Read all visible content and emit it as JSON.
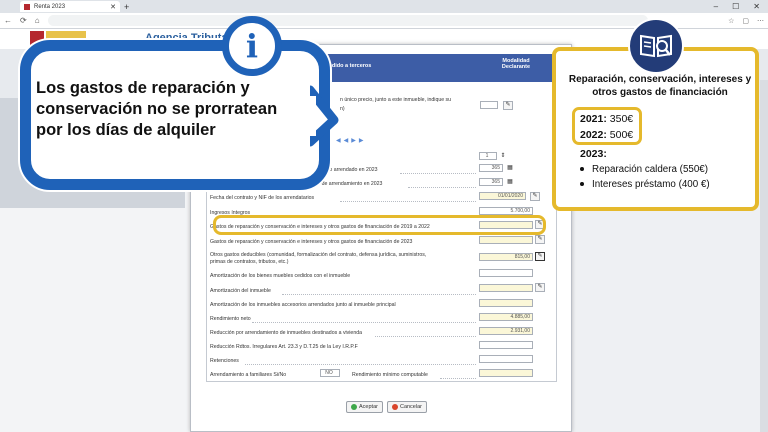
{
  "browser": {
    "tab_title": "Renta 2023",
    "tab_close": "✕",
    "new_tab": "+",
    "window_buttons": [
      "–",
      "☐",
      "✕"
    ],
    "nav": [
      "←",
      "⟳",
      "⌂"
    ]
  },
  "site": {
    "agency": "Agencia Tributaria"
  },
  "dialog": {
    "header_title": "o o cedido a terceros",
    "header_modalidad": "Modalidad Declarante",
    "row_precio": "n único precio, junto a este inmueble, indique su",
    "row_precio2": "n)",
    "stepper_value": "1",
    "row_dias_arrendado": "le ha estado arrendado en 2023",
    "dias_arrendado": "365",
    "row_dias_contrato": "ontrato de arrendamiento en 2023",
    "dias_contrato": "365",
    "row_fecha": "Fecha del contrato y NIF de los arrendatarios",
    "fecha": "01/01/2020",
    "row_ingresos": "Ingresos íntegros",
    "ingresos": "5.700,00",
    "row_gastos_anteriores": "Gastos de reparación y conservación e intereses y otros gastos de financiación de 2019 a 2022",
    "row_gastos_2023": "Gastos de reparación y conservación e intereses y otros gastos de financiación de 2023",
    "row_otros_gastos_1": "Otros gastos deducibles (comunidad, formalización del contrato, defensa jurídica, suministros,",
    "row_otros_gastos_2": "primas de contratos, tributos, etc.)",
    "otros_gastos": "815,00",
    "row_amort_muebles": "Amortización de los bienes muebles cedidos con el inmueble",
    "row_amort_inmueble": "Amortización del inmueble",
    "row_amort_accesorios": "Amortización de los inmuebles accesorios arrendados junto al inmueble principal",
    "row_rendimiento_neto": "Rendimiento neto",
    "rendimiento_neto": "4.885,00",
    "row_reduccion": "Reducción por arrendamiento de inmuebles destinados a vivienda",
    "reduccion": "2.931,00",
    "row_reduccion_irregulares": "Reducción Rdtos. Irregulares Art. 23.3 y D.T.25 de la Ley I.R.P.F",
    "row_retenciones": "Retenciones",
    "row_familiares": "Arrendamiento a familiares Si/No",
    "familiares": "NO",
    "row_minimo": "Rendimiento mínimo computable",
    "aceptar": "Aceptar",
    "cancelar": "Cancelar"
  },
  "callout": {
    "icon_letter": "i",
    "text": "Los gastos de reparación y conservación no se prorratean por los días de alquiler"
  },
  "card": {
    "title": "Reparación, conservación, intereses y otros gastos de financiación",
    "y2021_label": "2021:",
    "y2021_value": "350€",
    "y2022_label": "2022:",
    "y2022_value": "500€",
    "y2023_label": "2023:",
    "items": [
      "Reparación caldera (550€)",
      "Intereses préstamo (400 €)"
    ]
  },
  "colors": {
    "callout_blue": "#1f62b8",
    "highlight_yellow": "#e5b92c",
    "dialog_header": "#3d5da6"
  }
}
